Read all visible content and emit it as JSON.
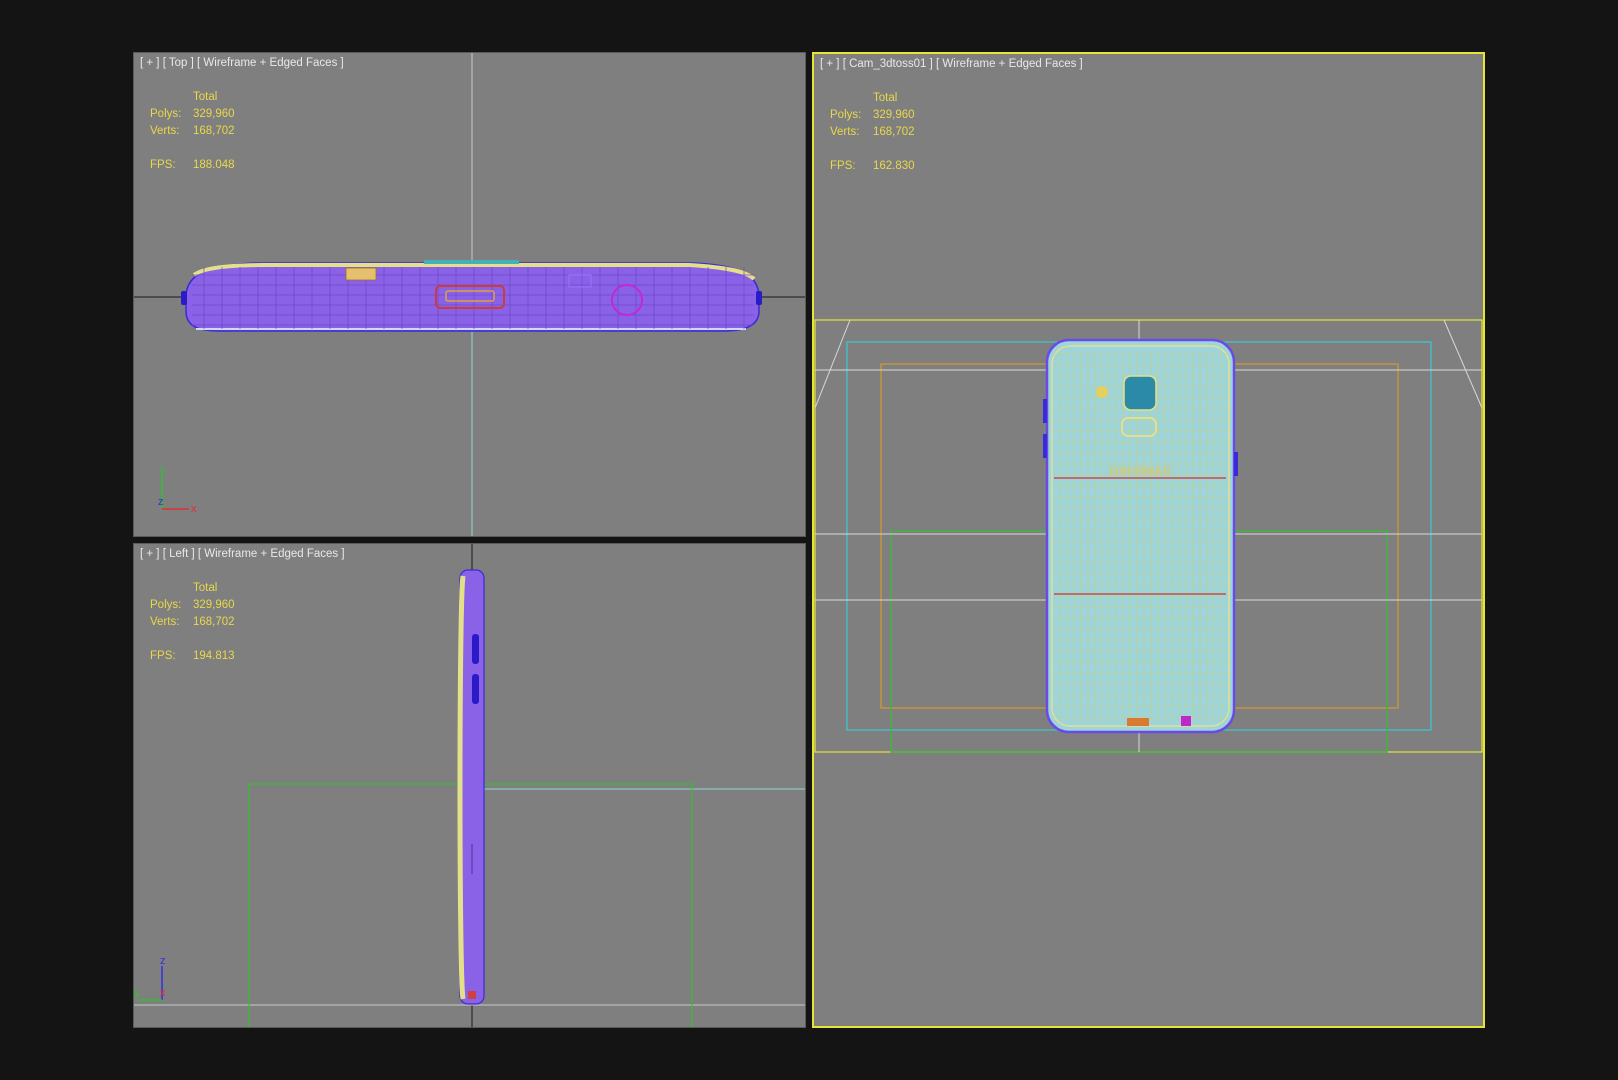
{
  "viewports": [
    {
      "id": "top",
      "label": {
        "plus": "[ + ]",
        "view": "[ Top ]",
        "mode": "[ Wireframe + Edged Faces ]"
      },
      "stats": {
        "header": "Total",
        "polys_label": "Polys:",
        "polys": "329,960",
        "verts_label": "Verts:",
        "verts": "168,702",
        "fps_label": "FPS:",
        "fps": "188.048"
      },
      "axes": {
        "a": "y",
        "b": "z",
        "c": "x"
      }
    },
    {
      "id": "left",
      "label": {
        "plus": "[ + ]",
        "view": "[ Left ]",
        "mode": "[ Wireframe + Edged Faces ]"
      },
      "stats": {
        "header": "Total",
        "polys_label": "Polys:",
        "polys": "329,960",
        "verts_label": "Verts:",
        "verts": "168,702",
        "fps_label": "FPS:",
        "fps": "194.813"
      },
      "axes": {
        "a": "z",
        "b": "y",
        "c": "x"
      }
    },
    {
      "id": "camera",
      "label": {
        "plus": "[ + ]",
        "view": "[ Cam_3dtoss01 ]",
        "mode": "[ Wireframe + Edged Faces ]"
      },
      "stats": {
        "header": "Total",
        "polys_label": "Polys:",
        "polys": "329,960",
        "verts_label": "Verts:",
        "verts": "168,702",
        "fps_label": "FPS:",
        "fps": "162.830"
      },
      "brand_text": "SAMSUNG",
      "active": true
    }
  ],
  "colors": {
    "viewport_bg": "#7f7f7f",
    "active_border": "#e6e632",
    "stats_text": "#e8d84a",
    "wire_purple": "#8a5cf0",
    "wire_blue": "#3a2ad8",
    "wire_yellow": "#e4e08a",
    "wire_cyan": "#8fd8e0",
    "frame_green": "#35c035",
    "frame_orange": "#d49a28",
    "frame_cyan": "#3ac8d8"
  }
}
